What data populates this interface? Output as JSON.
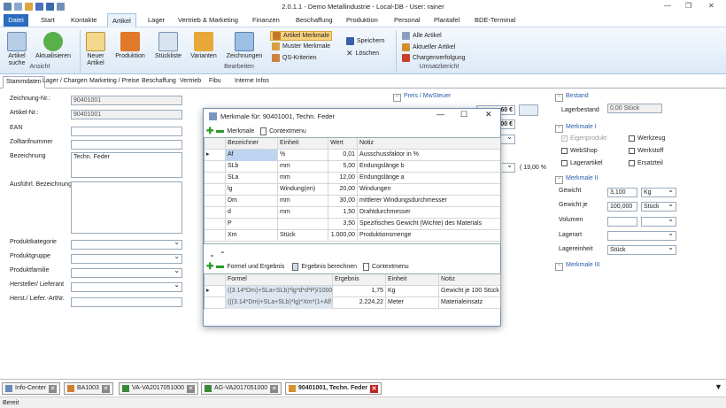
{
  "window": {
    "title": "2.0.1.1 - Demo Metallindustrie - Local-DB - User: rainer"
  },
  "ribbon_tabs": [
    "Datei",
    "Start",
    "Kontakte",
    "Artikel",
    "Lager",
    "Vertrieb & Marketing",
    "Finanzen",
    "Beschaffung",
    "Produktion",
    "Personal",
    "Plantafel",
    "BDE-Terminal"
  ],
  "ribbon": {
    "artikel_suche": "Artikel suche",
    "aktualisieren": "Aktualisieren",
    "group_ansicht": "Ansicht",
    "neuer_artikel": "Neuer Artikel",
    "produktion": "Produktion",
    "stueckliste": "Stückliste",
    "varianten": "Varianten",
    "zeichnungen": "Zeichnungen",
    "artikel_merkmale": "Artikel Merkmale",
    "muster_merkmale": "Muster Merkmale",
    "qs_kriterien": "QS-Kriterien",
    "speichern": "Speichern",
    "loeschen": "Löschen",
    "group_bearbeiten": "Bearbeiten",
    "alle_artikel": "Alle Artikel",
    "aktueller_artikel": "Aktueller Artikel",
    "chargenverfolgung": "Chargenverfolgung",
    "group_umsatz": "Umsatzbericht"
  },
  "main_tabs": [
    "Stammdaten",
    "Lager / Chargen",
    "Marketing / Preise",
    "Beschaffung",
    "Vertrieb",
    "Fibu",
    "Interne Infos"
  ],
  "form": {
    "zeichnung_label": "Zeichnung-Nr.:",
    "zeichnung_value": "90401001",
    "artikel_label": "Artikel-Nr.:",
    "artikel_value": "90401001",
    "ean_label": "EAN",
    "zoll_label": "Zolltarifnummer",
    "bez_label": "Bezeichnung",
    "bez_value": "Techn. Feder",
    "ausf_label": "Ausführl. Bezeichnung",
    "kat_label": "Produktkategorie",
    "gruppe_label": "Produktgruppe",
    "familie_label": "Produktfamilie",
    "hersteller_label": "Hersteller/ Lieferant",
    "herst_nr_label": "Herst./ Liefer.-ArtNr."
  },
  "preis": {
    "section": "Preis / MwSteuer",
    "v1": "60 €",
    "v2": "00 €",
    "vat": "( 19,00 %"
  },
  "bestand": {
    "section": "Bestand",
    "label": "Lagerbestand",
    "value": "0,00 Stück"
  },
  "merkmale1": {
    "section": "Merkmale I",
    "eigenprodukt": "Eigenprodukt",
    "werkzeug": "Werkzeug",
    "webshop": "WebShop",
    "werkstoff": "Werkstoff",
    "lagerartikel": "Lagerartikel",
    "ersatzteil": "Ersatzteil"
  },
  "merkmale2": {
    "section": "Merkmale II",
    "gewicht": "Gewicht",
    "gewicht_value": "3,100",
    "gewicht_unit": "Kg",
    "gewicht_je": "Gewicht je",
    "gewicht_je_value": "100,000",
    "gewicht_je_unit": "Stück",
    "volumen": "Volumen",
    "lagerart": "Lagerart",
    "lagereinheit": "Lagereinheit",
    "lagereinheit_value": "Stück"
  },
  "merkmale3": {
    "section": "Merkmale III"
  },
  "dialog": {
    "title": "Merkmale für: 90401001, Techn. Feder",
    "tb_merkmale": "Merkmale",
    "tb_context": "Contextmenu",
    "headers": [
      "Bezeichner",
      "Einheit",
      "Wert",
      "Notiz"
    ],
    "rows": [
      {
        "b": "Af",
        "e": "%",
        "w": "0,01",
        "n": "Ausschussfaktor in %"
      },
      {
        "b": "SLb",
        "e": "mm",
        "w": "5,00",
        "n": "Endungslänge b"
      },
      {
        "b": "SLa",
        "e": "mm",
        "w": "12,00",
        "n": "Endungslänge a"
      },
      {
        "b": "lg",
        "e": "Windung(en)",
        "w": "20,00",
        "n": "Windungen"
      },
      {
        "b": "Dm",
        "e": "mm",
        "w": "30,00",
        "n": "mittlerer Windungsdurchmesser"
      },
      {
        "b": "d",
        "e": "mm",
        "w": "1,50",
        "n": "Drahtdurchmesser"
      },
      {
        "b": "P",
        "e": "",
        "w": "3,50",
        "n": "Spezifisches Gewicht (Wichte) des Materials"
      },
      {
        "b": "Xm",
        "e": "Stück",
        "w": "1.000,00",
        "n": "Produktionsmenge"
      }
    ],
    "tb_formel": "Formel und Ergebnis",
    "tb_berechnen": "Ergebnis berechnen",
    "tb_context2": "Contextmenu",
    "headers2": [
      "Formel",
      "Ergebnis",
      "Einheit",
      "Notiz"
    ],
    "rows2": [
      {
        "f": "((3.14*Dm)+SLa+SLb)*lg*d*d*P)/1000...",
        "r": "1,75",
        "e": "Kg",
        "n": "Gewicht je 100 Stück"
      },
      {
        "f": "(((3.14*Dm)+SLa+SLb)*lg)*Xm*(1+Af/1...",
        "r": "2.224,22",
        "e": "Meter",
        "n": "Materialeinsatz"
      }
    ]
  },
  "doc_tabs": [
    "Info-Center",
    "BA1003",
    "VA-VA2017051000",
    "AG-VA2017051000",
    "90401001, Techn. Feder"
  ],
  "status": "Bereit"
}
